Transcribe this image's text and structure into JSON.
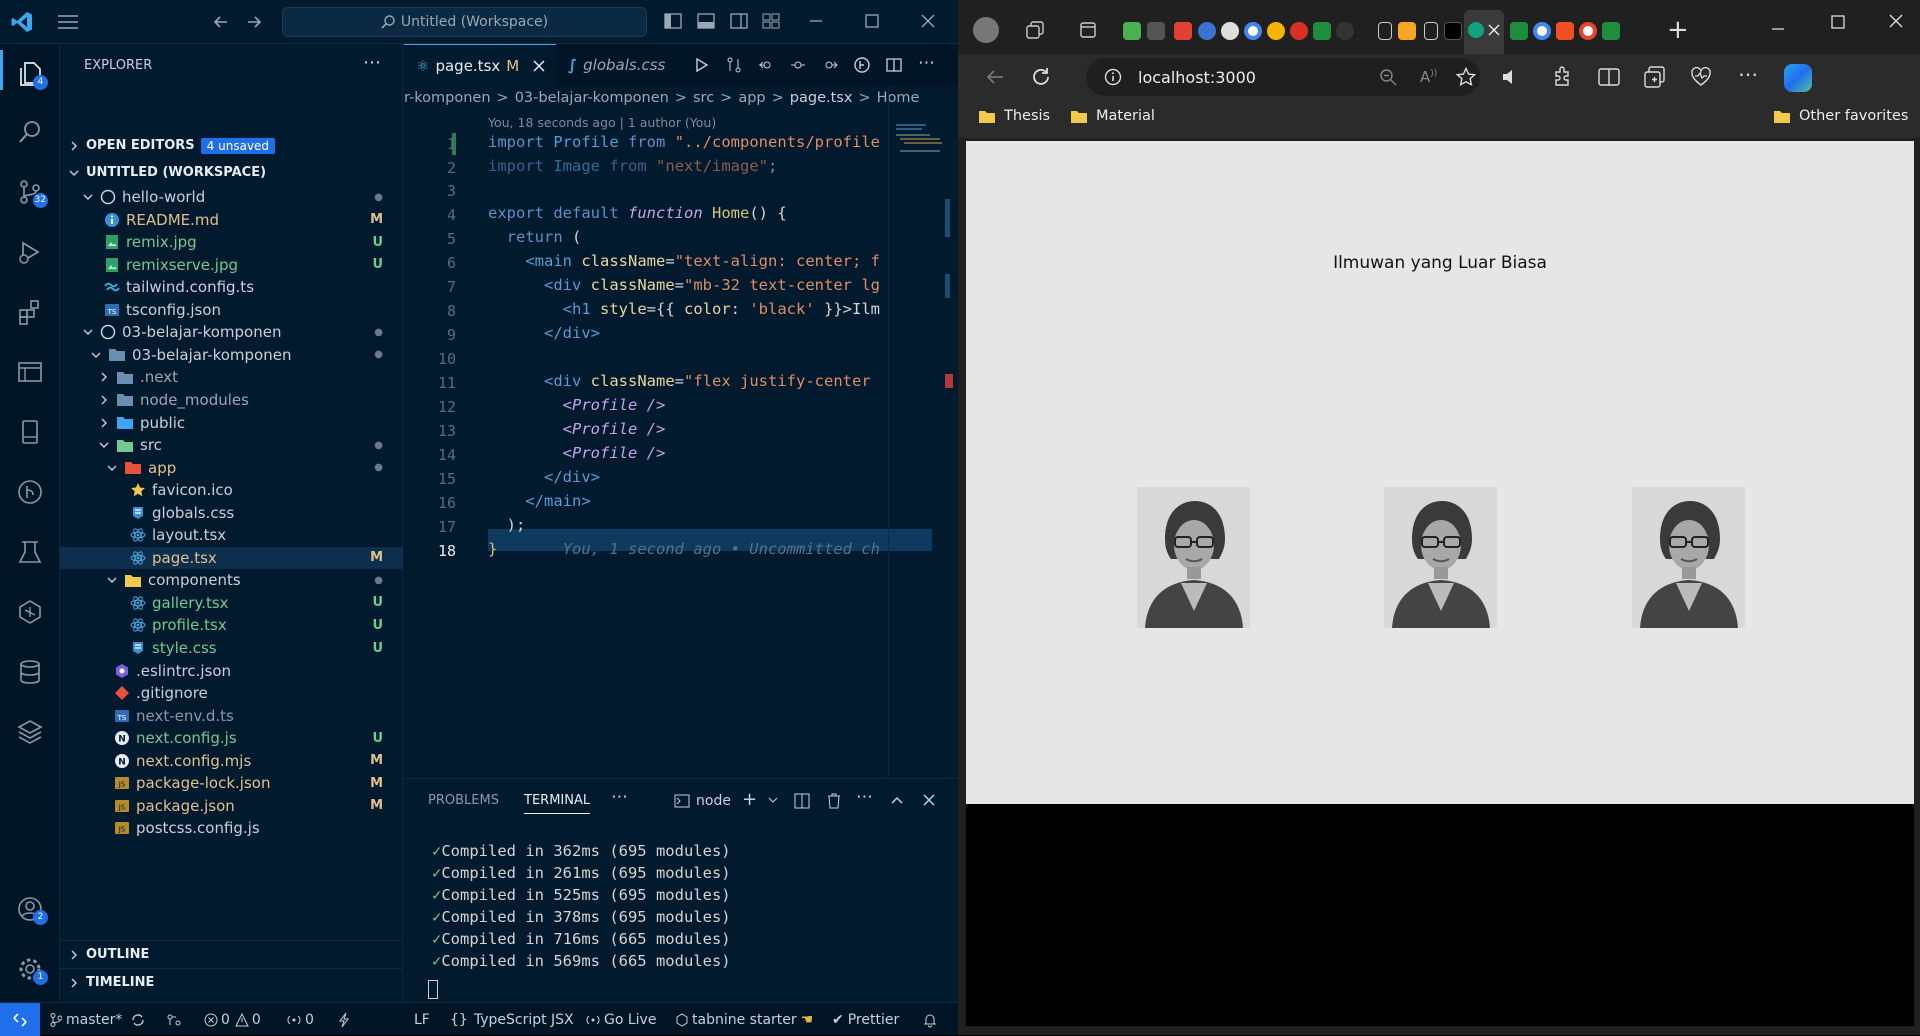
{
  "vscode": {
    "title_search": "Untitled (Workspace)",
    "activity_badges": {
      "explorer": "4",
      "source_control": "32",
      "accounts": "2",
      "settings": "1"
    },
    "explorer": {
      "title": "EXPLORER",
      "open_editors": "OPEN EDITORS",
      "unsaved_badge": "4 unsaved",
      "workspace": "UNTITLED (WORKSPACE)",
      "items": [
        {
          "label": "hello-world",
          "status": "●"
        },
        {
          "label": "README.md",
          "status": "M"
        },
        {
          "label": "remix.jpg",
          "status": "U"
        },
        {
          "label": "remixserve.jpg",
          "status": "U"
        },
        {
          "label": "tailwind.config.ts",
          "status": ""
        },
        {
          "label": "tsconfig.json",
          "status": ""
        },
        {
          "label": "03-belajar-komponen",
          "status": "●"
        },
        {
          "label": "03-belajar-komponen",
          "status": "●"
        },
        {
          "label": ".next",
          "status": ""
        },
        {
          "label": "node_modules",
          "status": ""
        },
        {
          "label": "public",
          "status": ""
        },
        {
          "label": "src",
          "status": "●"
        },
        {
          "label": "app",
          "status": "●"
        },
        {
          "label": "favicon.ico",
          "status": ""
        },
        {
          "label": "globals.css",
          "status": ""
        },
        {
          "label": "layout.tsx",
          "status": ""
        },
        {
          "label": "page.tsx",
          "status": "M"
        },
        {
          "label": "components",
          "status": "●"
        },
        {
          "label": "gallery.tsx",
          "status": "U"
        },
        {
          "label": "profile.tsx",
          "status": "U"
        },
        {
          "label": "style.css",
          "status": "U"
        },
        {
          "label": ".eslintrc.json",
          "status": ""
        },
        {
          "label": ".gitignore",
          "status": ""
        },
        {
          "label": "next-env.d.ts",
          "status": ""
        },
        {
          "label": "next.config.js",
          "status": "U"
        },
        {
          "label": "next.config.mjs",
          "status": "M"
        },
        {
          "label": "package-lock.json",
          "status": "M"
        },
        {
          "label": "package.json",
          "status": "M"
        },
        {
          "label": "postcss.config.js",
          "status": ""
        }
      ],
      "outline": "OUTLINE",
      "timeline": "TIMELINE"
    },
    "tabs": [
      {
        "label": "page.tsx",
        "status": "M"
      },
      {
        "label": "globals.css",
        "status": ""
      }
    ],
    "breadcrumb": [
      "r-komponen",
      "03-belajar-komponen",
      "src",
      "app",
      "page.tsx",
      "Home"
    ],
    "blame": "You, 18 seconds ago | 1 author (You)",
    "line_numbers": [
      "1",
      "2",
      "3",
      "4",
      "5",
      "6",
      "7",
      "8",
      "9",
      "10",
      "11",
      "12",
      "13",
      "14",
      "15",
      "16",
      "17",
      "18"
    ],
    "inline_blame": "You, 1 second ago • Uncommitted ch",
    "panel_tabs": {
      "problems": "PROBLEMS",
      "terminal": "TERMINAL",
      "shell": "node"
    },
    "terminal_lines": [
      "Compiled in 362ms (695 modules)",
      "Compiled in 261ms (695 modules)",
      "Compiled in 525ms (695 modules)",
      "Compiled in 378ms (695 modules)",
      "Compiled in 716ms (665 modules)",
      "Compiled in 569ms (665 modules)"
    ],
    "statusbar": {
      "branch": "master*",
      "errors": "0",
      "warnings": "0",
      "ports": "0",
      "eol": "LF",
      "language": "TypeScript JSX",
      "golive": "Go Live",
      "tabnine": "tabnine starter",
      "prettier": "Prettier"
    }
  },
  "browser": {
    "url": "localhost:3000",
    "favorites": [
      "Thesis",
      "Material"
    ],
    "other_favorites": "Other favorites",
    "page": {
      "heading": "Ilmuwan yang Luar Biasa",
      "profile_count": 3
    }
  }
}
